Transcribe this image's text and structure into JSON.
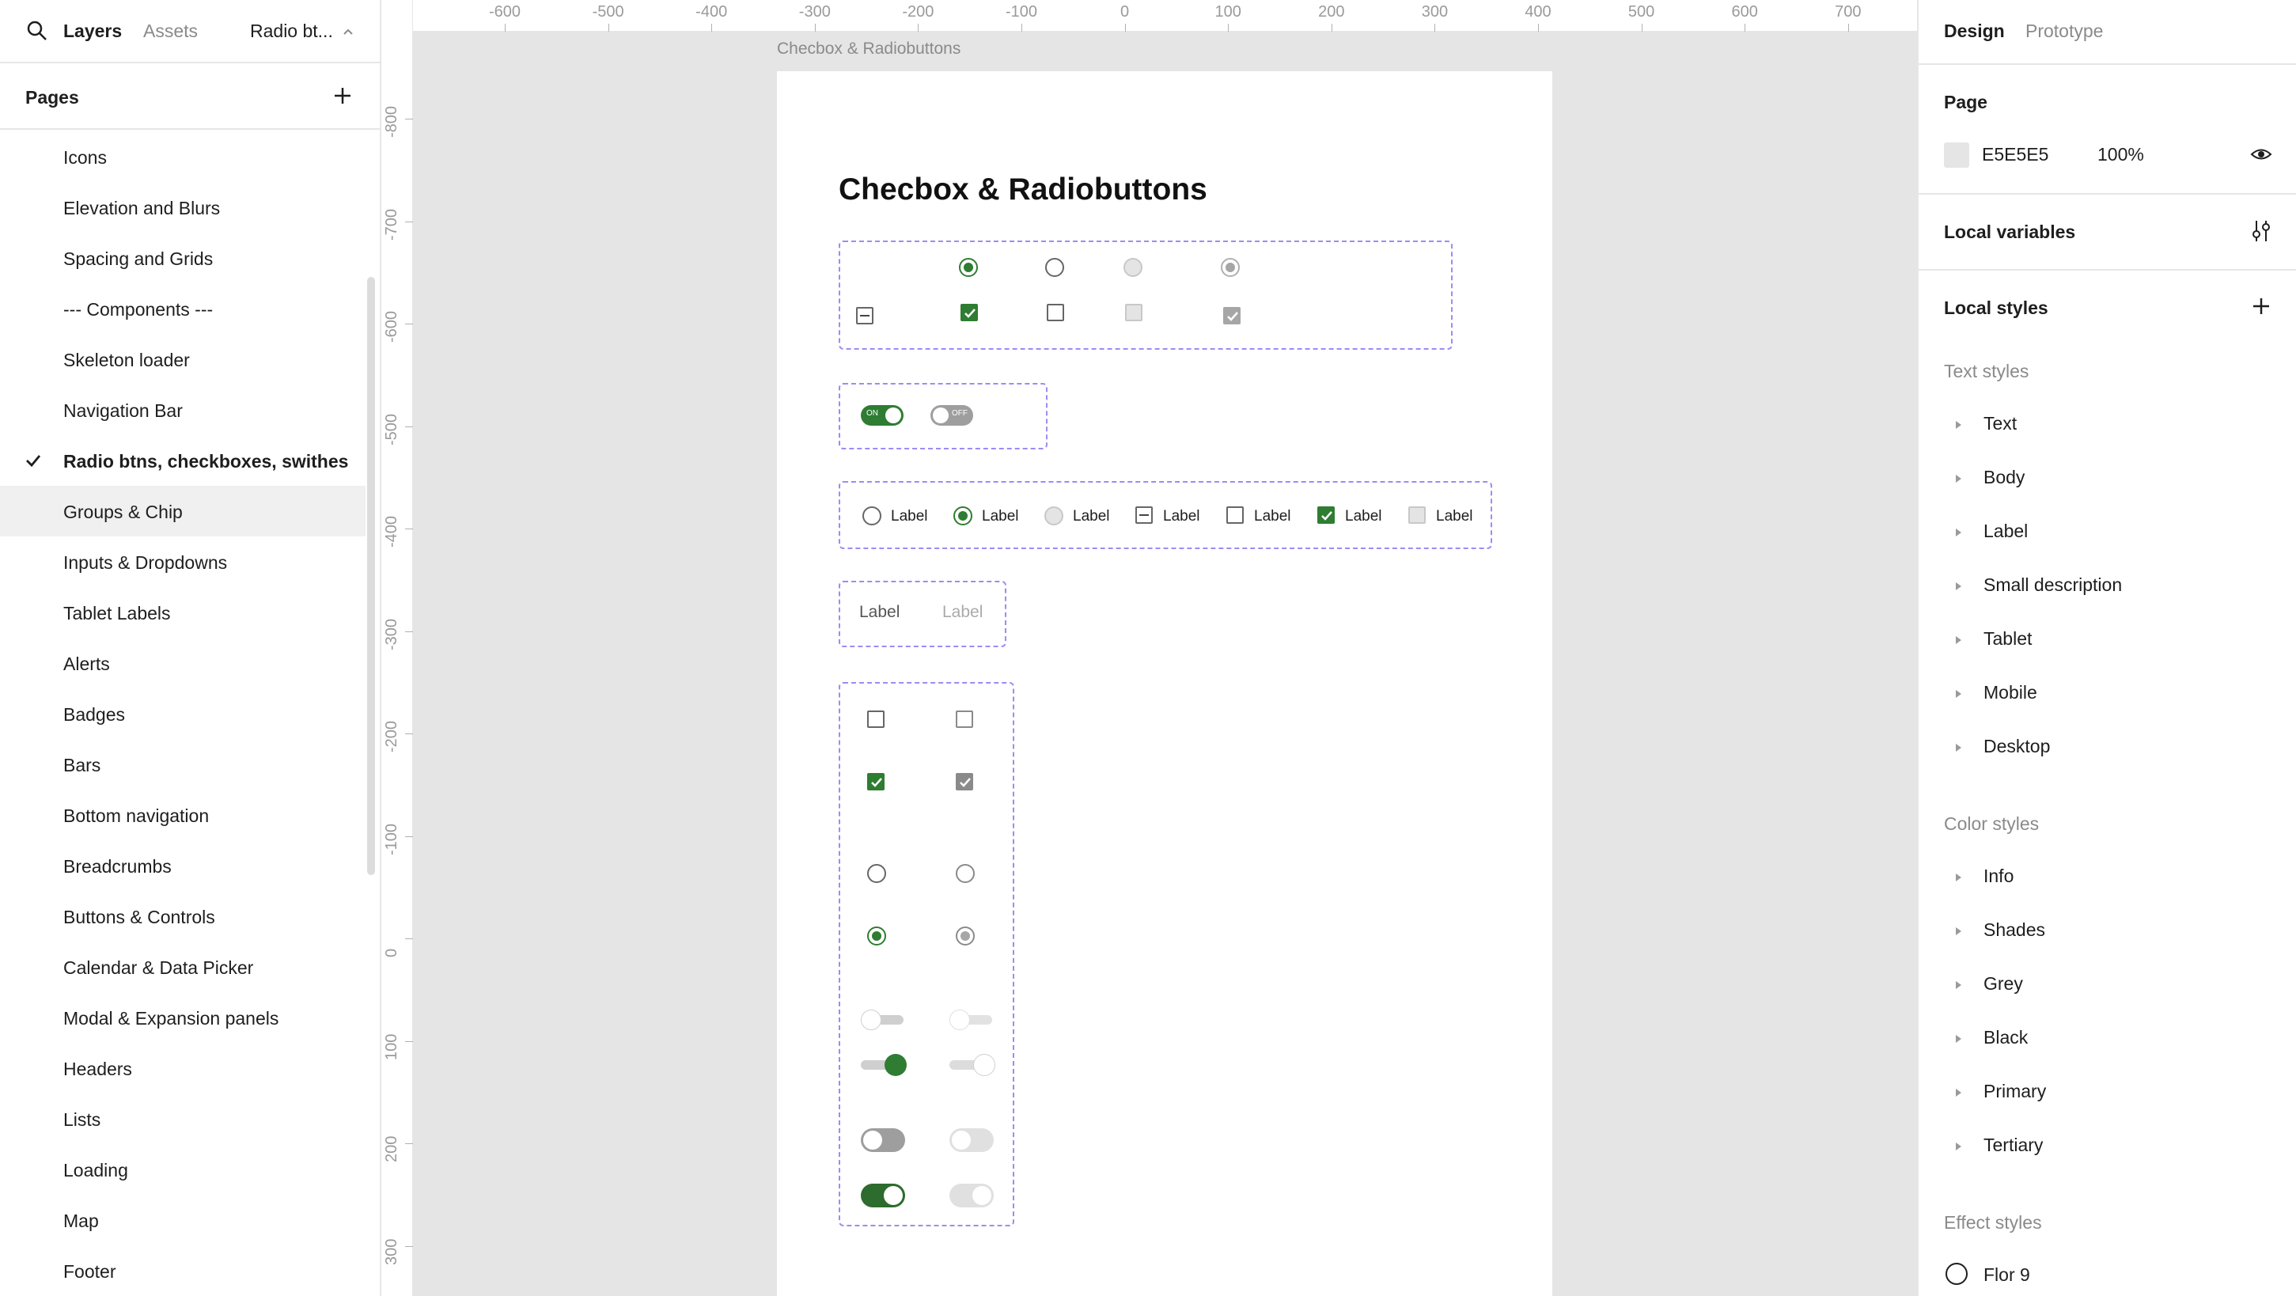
{
  "left_panel": {
    "tabs": {
      "layers": "Layers",
      "assets": "Assets"
    },
    "page_dropdown": "Radio bt...",
    "pages_header": "Pages",
    "pages": [
      {
        "label": "Icons"
      },
      {
        "label": "Elevation and Blurs"
      },
      {
        "label": "Spacing and Grids"
      },
      {
        "label": "--- Components ---"
      },
      {
        "label": "Skeleton loader"
      },
      {
        "label": "Navigation Bar"
      },
      {
        "label": "Radio btns, checkboxes, swithes",
        "active": true
      },
      {
        "label": "Groups & Chip",
        "hover": true
      },
      {
        "label": "Inputs & Dropdowns"
      },
      {
        "label": "Tablet Labels"
      },
      {
        "label": "Alerts"
      },
      {
        "label": "Badges"
      },
      {
        "label": "Bars"
      },
      {
        "label": "Bottom navigation"
      },
      {
        "label": "Breadcrumbs"
      },
      {
        "label": "Buttons & Controls"
      },
      {
        "label": "Calendar & Data Picker"
      },
      {
        "label": "Modal & Expansion panels"
      },
      {
        "label": "Headers"
      },
      {
        "label": "Lists"
      },
      {
        "label": "Loading"
      },
      {
        "label": "Map"
      },
      {
        "label": "Footer"
      }
    ]
  },
  "canvas": {
    "ruler_top": [
      "-600",
      "-500",
      "-400",
      "-300",
      "-200",
      "-100",
      "0",
      "100",
      "200",
      "300",
      "400",
      "500",
      "600",
      "700"
    ],
    "ruler_left": [
      "-800",
      "-700",
      "-600",
      "-500",
      "-400",
      "-300",
      "-200",
      "-100",
      "0",
      "100",
      "200",
      "300"
    ],
    "frame_name": "Checbox & Radiobuttons",
    "frame_title": "Checbox & Radiobuttons",
    "toggle_on_text": "ON",
    "toggle_off_text": "OFF",
    "label_row": [
      "Label",
      "Label",
      "Label",
      "Label",
      "Label",
      "Label",
      "Label"
    ],
    "chips": [
      "Label",
      "Label"
    ],
    "accent_color": "#2e7d32",
    "group_border_color": "#9b8cf5",
    "background_color": "#E5E5E5"
  },
  "right_panel": {
    "tabs": {
      "design": "Design",
      "prototype": "Prototype"
    },
    "page_section": {
      "title": "Page",
      "color": "E5E5E5",
      "opacity": "100%"
    },
    "local_variables": "Local variables",
    "local_styles": "Local styles",
    "text_styles": {
      "title": "Text styles",
      "items": [
        "Text",
        "Body",
        "Label",
        "Small description",
        "Tablet",
        "Mobile",
        "Desktop"
      ]
    },
    "color_styles": {
      "title": "Color styles",
      "items": [
        "Info",
        "Shades",
        "Grey",
        "Black",
        "Primary",
        "Tertiary"
      ]
    },
    "effect_styles": {
      "title": "Effect styles",
      "items": [
        "Flor 9"
      ]
    }
  }
}
